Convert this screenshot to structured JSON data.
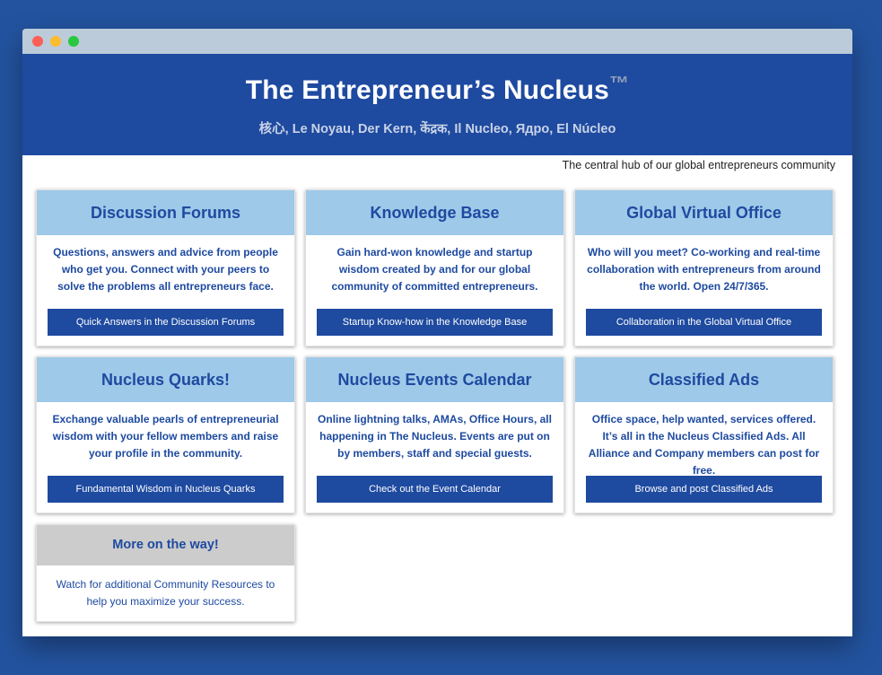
{
  "header": {
    "title": "The Entrepreneur’s Nucleus",
    "trademark": "™",
    "languages": "核心, Le Noyau, Der Kern, केंद्रक, Il Nucleo, Ядро, El Núcleo"
  },
  "tagline": "The central hub of our global entrepreneurs community",
  "cards": [
    {
      "title": "Discussion Forums",
      "text": "Questions, answers and advice from people who get you. Connect with your peers to solve the problems all entrepreneurs face.",
      "button": "Quick Answers in the Discussion Forums"
    },
    {
      "title": "Knowledge Base",
      "text": "Gain hard-won knowledge and startup wisdom created by and for our global community of committed entrepreneurs.",
      "button": "Startup Know-how in the Knowledge Base"
    },
    {
      "title": "Global Virtual Office",
      "text": "Who will you meet? Co-working and real-time collaboration with entrepreneurs from around the world. Open 24/7/365.",
      "button": "Collaboration in the Global Virtual Office"
    },
    {
      "title": "Nucleus Quarks!",
      "text": "Exchange valuable pearls of entrepreneurial wisdom with your fellow members and raise your profile in the community.",
      "button": "Fundamental Wisdom in Nucleus Quarks"
    },
    {
      "title": "Nucleus Events Calendar",
      "text": "Online lightning talks, AMAs, Office Hours, all happening in The Nucleus. Events are put on by members, staff and special guests.",
      "button": "Check out the Event Calendar"
    },
    {
      "title": "Classified Ads",
      "text": "Office space, help wanted, services offered. It’s all in the Nucleus Classified Ads. All Alliance and Company members can post for free.",
      "button": "Browse and post Classified Ads"
    }
  ],
  "more": {
    "title": "More on the way!",
    "text": "Watch for additional Community Resources to help you maximize your success."
  }
}
